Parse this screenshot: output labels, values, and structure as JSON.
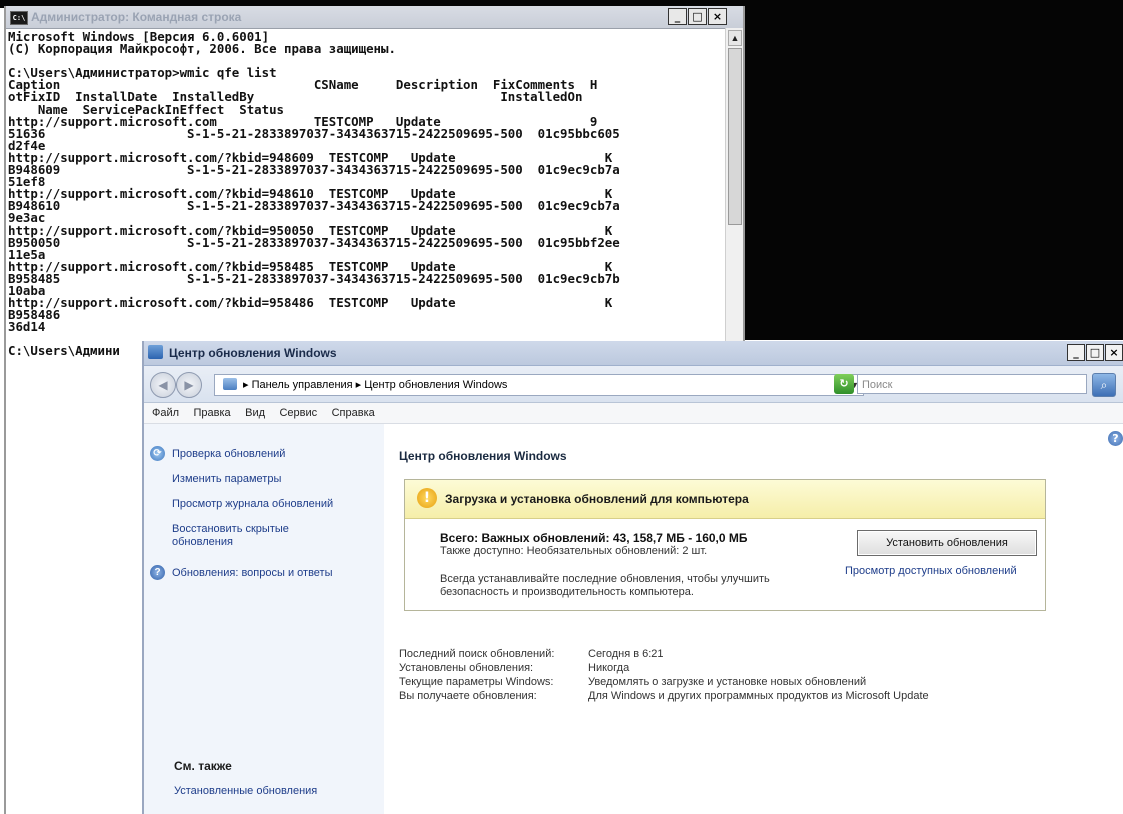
{
  "cmd_window": {
    "title": "Администратор: Командная строка",
    "icon_label": "C:\\",
    "controls": [
      "_",
      "□",
      "×"
    ],
    "lines": [
      "Microsoft Windows [Версия 6.0.6001]",
      "(C) Корпорация Майкрософт, 2006. Все права защищены.",
      "",
      "C:\\Users\\Администратор>wmic qfe list",
      "Caption                                  CSName     Description  FixComments  H",
      "otFixID  InstallDate  InstalledBy                                 InstalledOn",
      "    Name  ServicePackInEffect  Status",
      "http://support.microsoft.com             TESTCOMP   Update                    9",
      "51636                   S-1-5-21-2833897037-3434363715-2422509695-500  01c95bbc605",
      "d2f4e",
      "http://support.microsoft.com/?kbid=948609  TESTCOMP   Update                    K",
      "B948609                 S-1-5-21-2833897037-3434363715-2422509695-500  01c9ec9cb7a",
      "51ef8",
      "http://support.microsoft.com/?kbid=948610  TESTCOMP   Update                    K",
      "B948610                 S-1-5-21-2833897037-3434363715-2422509695-500  01c9ec9cb7a",
      "9e3ac",
      "http://support.microsoft.com/?kbid=950050  TESTCOMP   Update                    K",
      "B950050                 S-1-5-21-2833897037-3434363715-2422509695-500  01c95bbf2ee",
      "11e5a",
      "http://support.microsoft.com/?kbid=958485  TESTCOMP   Update                    K",
      "B958485                 S-1-5-21-2833897037-3434363715-2422509695-500  01c9ec9cb7b",
      "10aba",
      "http://support.microsoft.com/?kbid=958486  TESTCOMP   Update                    K",
      "B958486",
      "36d14",
      "",
      "C:\\Users\\Админи"
    ]
  },
  "update_window": {
    "title": "Центр обновления Windows",
    "controls": [
      "_",
      "□",
      "×"
    ],
    "address": {
      "path": "▸ Панель управления ▸ Центр обновления Windows",
      "refresh_icon": "refresh-icon",
      "search_placeholder": "Поиск",
      "search_icon": "search-icon"
    },
    "menu": [
      "Файл",
      "Правка",
      "Вид",
      "Сервис",
      "Справка"
    ],
    "tasks": {
      "check": "Проверка обновлений",
      "change": "Изменить параметры",
      "history": "Просмотр журнала обновлений",
      "restore_1": "Восстановить скрытые",
      "restore_2": "обновления",
      "faq": "Обновления: вопросы и ответы"
    },
    "see_also": {
      "title": "См. также",
      "installed": "Установленные обновления"
    },
    "main": {
      "title": "Центр обновления Windows",
      "status_title": "Загрузка и установка обновлений для компьютера",
      "total": "Всего: Важных обновлений: 43, 158,7 МБ - 160,0 МБ",
      "also": "Также доступно: Необязательных обновлений: 2 шт.",
      "advice_1": "Всегда устанавливайте последние обновления, чтобы улучшить",
      "advice_2": "безопасность и производительность компьютера.",
      "install_button": "Установить обновления",
      "view_available": "Просмотр доступных обновлений"
    },
    "info": [
      {
        "label": "Последний поиск обновлений:",
        "value": "Сегодня в 6:21"
      },
      {
        "label": "Установлены обновления:",
        "value": "Никогда"
      },
      {
        "label": "Текущие параметры Windows:",
        "value": "Уведомлять о загрузке и установке новых обновлений"
      },
      {
        "label": "Вы получаете обновления:",
        "value": "Для Windows и других программных продуктов из Microsoft Update"
      }
    ]
  }
}
